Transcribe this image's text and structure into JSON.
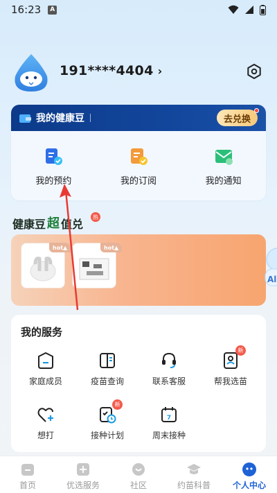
{
  "status_bar": {
    "time": "16:23",
    "notif_letter": "A"
  },
  "profile": {
    "phone": "191****4404",
    "chevron": "›"
  },
  "bean_card": {
    "title": "我的健康豆",
    "exchange_label": "去兑换",
    "items": [
      {
        "label": "我的预约",
        "icon": "appointment-icon"
      },
      {
        "label": "我的订阅",
        "icon": "subscription-icon"
      },
      {
        "label": "我的通知",
        "icon": "notification-icon"
      }
    ]
  },
  "promo": {
    "title_part1": "健康豆",
    "title_part2": "超",
    "title_part3": "值兑",
    "hot_badge": "热",
    "product_tag": "hot▲",
    "side_label": "All"
  },
  "services": {
    "title": "我的服务",
    "new_badge": "新",
    "items": [
      {
        "label": "家庭成员",
        "icon": "family-icon"
      },
      {
        "label": "疫苗查询",
        "icon": "vaccine-query-icon"
      },
      {
        "label": "联系客服",
        "icon": "customer-service-icon"
      },
      {
        "label": "帮我选苗",
        "icon": "select-vaccine-icon",
        "badge": true
      },
      {
        "label": "想打",
        "icon": "heart-plus-icon"
      },
      {
        "label": "接种计划",
        "icon": "vaccination-plan-icon",
        "badge": true
      },
      {
        "label": "周末接种",
        "icon": "calendar-icon",
        "calendar_day": "7"
      }
    ]
  },
  "bottom_nav": [
    {
      "label": "首页",
      "icon": "home-icon"
    },
    {
      "label": "优选服务",
      "icon": "plus-service-icon"
    },
    {
      "label": "社区",
      "icon": "community-icon"
    },
    {
      "label": "约苗科普",
      "icon": "education-icon"
    },
    {
      "label": "个人中心",
      "icon": "profile-icon",
      "active": true
    }
  ],
  "colors": {
    "accent": "#1e62d6",
    "bean_header": "#0d3a8a",
    "badge_red": "#f24a3a",
    "annotation_red": "#e83a33"
  }
}
